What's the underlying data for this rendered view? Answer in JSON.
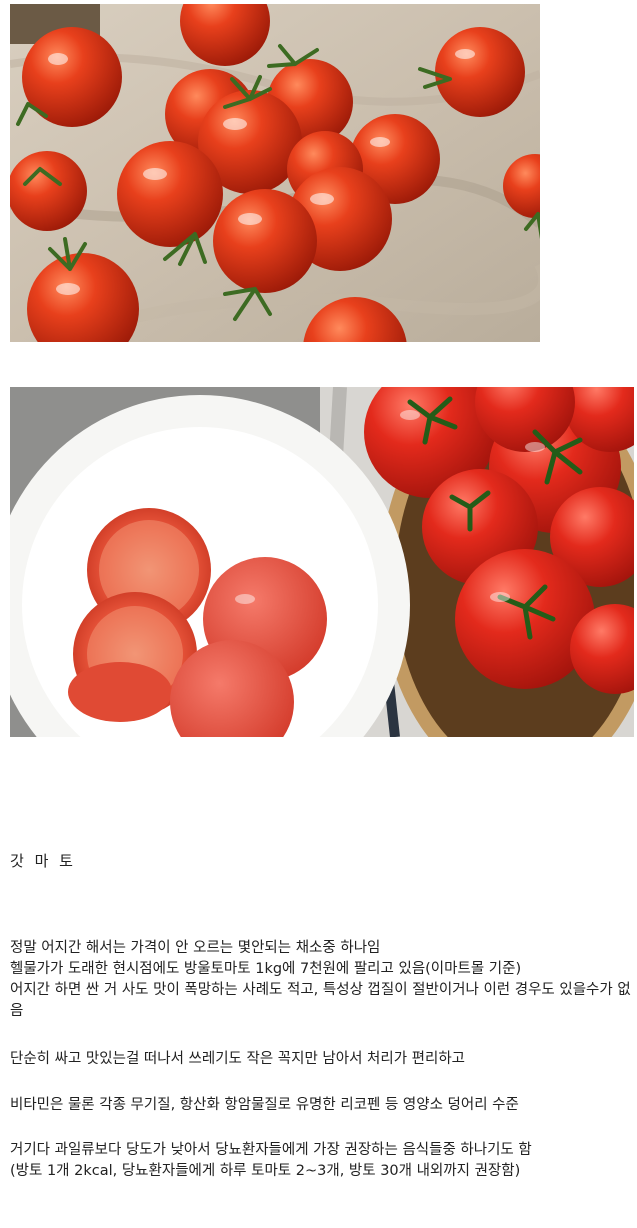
{
  "photos": [
    {
      "name": "cherry-tomatoes-on-linen-photo"
    },
    {
      "name": "tomatoes-plate-and-basket-photo"
    }
  ],
  "article": {
    "title": "갓 마 토",
    "paragraphs": [
      "정말 어지간 해서는 가격이 안 오르는 몇안되는 채소중 하나임\n헬물가가 도래한 현시점에도 방울토마토 1kg에 7천원에 팔리고 있음(이마트몰 기준)\n어지간 하면 싼 거 사도 맛이 폭망하는 사례도 적고, 특성상 껍질이 절반이거나 이런 경우도 있을수가 없음",
      "단순히 싸고 맛있는걸 떠나서 쓰레기도 작은 꼭지만 남아서 처리가 편리하고",
      "비타민은 물론 각종 무기질, 항산화 항암물질로 유명한 리코펜 등 영양소 덩어리 수준",
      "거기다 과일류보다 당도가 낮아서 당뇨환자들에게 가장 권장하는 음식들중 하나기도 함\n(방토 1개 2kcal, 당뇨환자들에게 하루 토마토 2~3개, 방토 30개 내외까지 권장함)"
    ]
  }
}
